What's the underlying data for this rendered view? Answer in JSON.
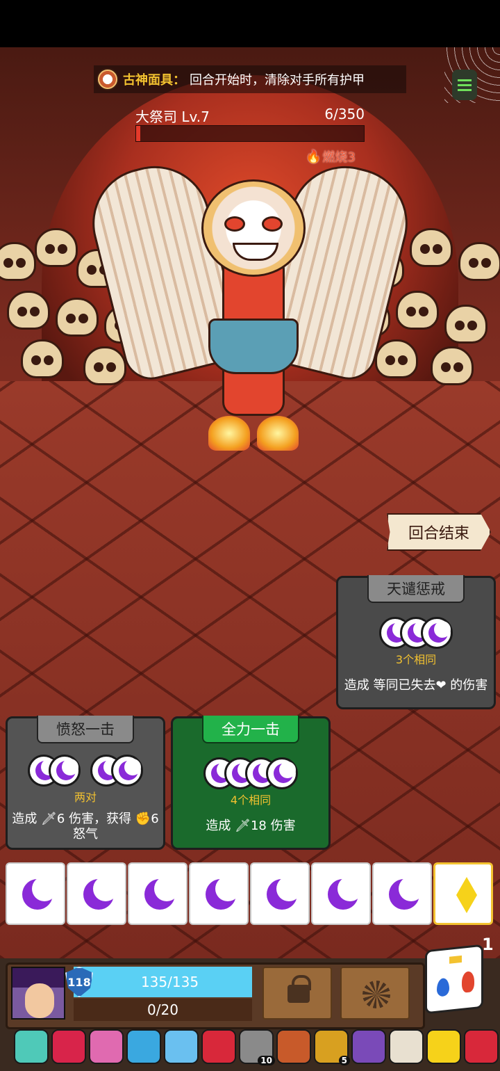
{
  "relic_banner": {
    "name": "古神面具：",
    "text": "回合开始时，清除对手所有护甲"
  },
  "boss": {
    "name": "大祭司 Lv.7",
    "hp_text": "6/350",
    "hp_fraction": 0.017,
    "status_text": "燃烧3"
  },
  "end_turn_label": "回合结束",
  "cards": {
    "wrath": {
      "title": "天谴惩戒",
      "condition": "3个相同",
      "effect": "造成 等同已失去❤ 的伤害"
    },
    "rage_strike": {
      "title": "愤怒一击",
      "condition": "两对",
      "effect": "造成 🗡6 伤害，获得 ✊6 怒气"
    },
    "full_strike": {
      "title": "全力一击",
      "condition": "4个相同",
      "effect": "造成 🗡18 伤害"
    }
  },
  "dice": [
    "moon",
    "moon",
    "moon",
    "moon",
    "moon",
    "moon",
    "moon",
    "diamond"
  ],
  "player": {
    "armor": "118",
    "hp_text": "135/135",
    "rage_text": "0/20"
  },
  "reroll_count": "1",
  "relics": [
    {
      "icon": "chest-icon",
      "color": "#4fc9b8",
      "badge": ""
    },
    {
      "icon": "flower-icon",
      "color": "#d8244a",
      "badge": ""
    },
    {
      "icon": "gem-icon",
      "color": "#e06ab0",
      "badge": ""
    },
    {
      "icon": "skull-gem-icon",
      "color": "#3aa8e0",
      "badge": ""
    },
    {
      "icon": "crystal-icon",
      "color": "#6ac0f0",
      "badge": ""
    },
    {
      "icon": "ruby-icon",
      "color": "#d8283a",
      "badge": ""
    },
    {
      "icon": "boot-icon",
      "color": "#8a8a8a",
      "badge": "10"
    },
    {
      "icon": "ring-icon",
      "color": "#c85a2a",
      "badge": ""
    },
    {
      "icon": "helmet-icon",
      "color": "#d8a020",
      "badge": "5"
    },
    {
      "icon": "orb-icon",
      "color": "#7a4ab8",
      "badge": ""
    },
    {
      "icon": "scroll-icon",
      "color": "#e8e0d0",
      "badge": ""
    },
    {
      "icon": "gold-die-icon",
      "color": "#f6d21a",
      "badge": ""
    },
    {
      "icon": "red-amulet-icon",
      "color": "#d8283a",
      "badge": ""
    }
  ]
}
